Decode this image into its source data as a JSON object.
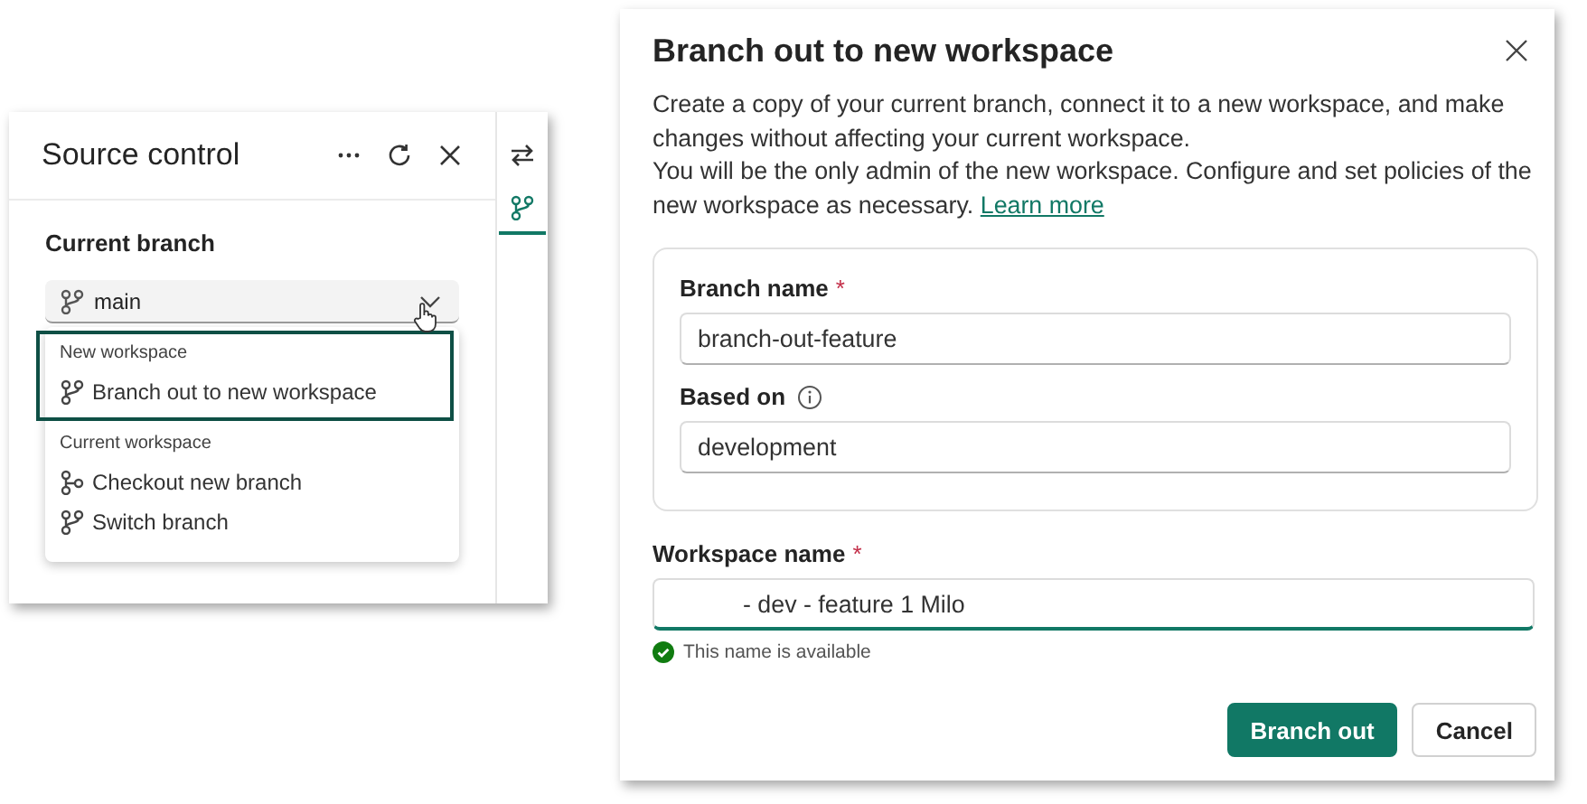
{
  "source_control": {
    "title": "Source control",
    "section_label": "Current branch",
    "branch_dropdown": {
      "value": "main"
    },
    "menu": [
      {
        "heading": "New workspace",
        "highlighted": true,
        "items": [
          {
            "label": "Branch out to new workspace",
            "kind": "branch"
          }
        ]
      },
      {
        "heading": "Current workspace",
        "highlighted": false,
        "items": [
          {
            "label": "Checkout new branch",
            "kind": "checkout"
          },
          {
            "label": "Switch branch",
            "kind": "branch"
          }
        ]
      }
    ],
    "rail": [
      {
        "kind": "swap",
        "selected": false
      },
      {
        "kind": "branch",
        "selected": true
      }
    ]
  },
  "dialog": {
    "title": "Branch out to new workspace",
    "description": [
      "Create a copy of your current branch, connect it to a new workspace, and make changes without affecting your current workspace.",
      "You will be the only admin of the new workspace. Configure and set policies of the new workspace as necessary."
    ],
    "link": "Learn more",
    "branch_group": [
      {
        "label": "Branch name",
        "required_mark": "*",
        "info": false,
        "value": "branch-out-feature"
      },
      {
        "label": "Based on",
        "info": true,
        "value": "development"
      }
    ],
    "workspace_field": {
      "label": "Workspace name",
      "required_mark": "*",
      "value": "- dev - feature 1 Milo",
      "focused": true
    },
    "validation": {
      "message": "This name is available"
    },
    "buttons": [
      {
        "label": "Branch out",
        "primary": true
      },
      {
        "label": "Cancel",
        "primary": false
      }
    ]
  }
}
